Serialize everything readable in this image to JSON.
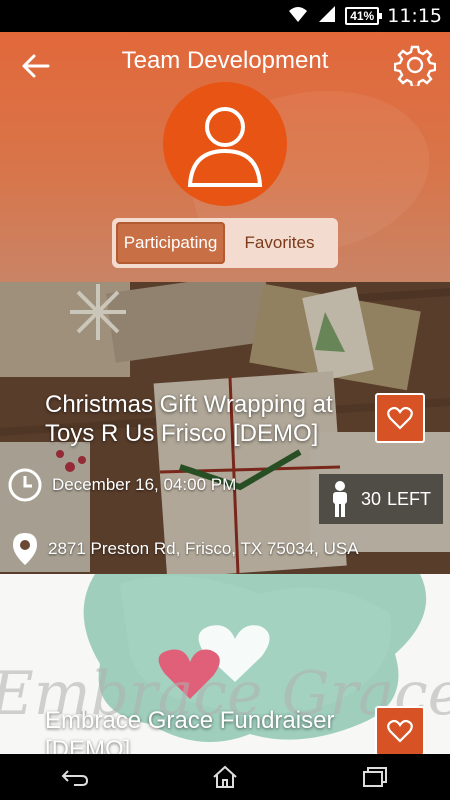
{
  "status_bar": {
    "time": "11:15",
    "battery": "41%",
    "icons": [
      "wifi-icon",
      "signal-icon",
      "battery-icon"
    ]
  },
  "header": {
    "title": "Team Development",
    "back_icon": "arrow-left-icon",
    "settings_icon": "gear-icon",
    "avatar_icon": "person-icon",
    "tabs": [
      {
        "label": "Participating",
        "active": true
      },
      {
        "label": "Favorites",
        "active": false
      }
    ],
    "accent_color": "#e75413"
  },
  "events": [
    {
      "title": "Christmas Gift Wrapping at Toys R Us Frisco [DEMO]",
      "datetime": "December 16, 04:00 PM",
      "spots_left": "30",
      "spots_left_suffix": "LEFT",
      "address": "2871 Preston Rd, Frisco, TX 75034, USA",
      "favorite_icon": "heart-outline-icon"
    },
    {
      "title": "Embrace Grace Fundraiser [DEMO]",
      "favorite_icon": "heart-outline-icon"
    }
  ],
  "nav_bar": {
    "icons": [
      "back-nav-icon",
      "home-nav-icon",
      "recents-nav-icon"
    ]
  }
}
